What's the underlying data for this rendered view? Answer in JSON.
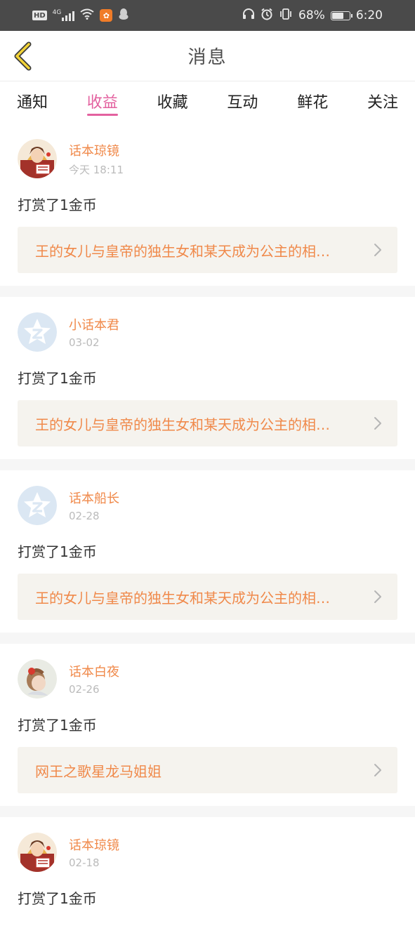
{
  "status_bar": {
    "hd": "HD",
    "network": "4G",
    "battery": "68%",
    "battery_level": 0.68,
    "time": "6:20"
  },
  "header": {
    "title": "消息"
  },
  "tabs": [
    {
      "label": "通知",
      "active": false
    },
    {
      "label": "收益",
      "active": true
    },
    {
      "label": "收藏",
      "active": false
    },
    {
      "label": "互动",
      "active": false
    },
    {
      "label": "鲜花",
      "active": false
    },
    {
      "label": "关注",
      "active": false
    }
  ],
  "accent_color": "#e3619f",
  "name_color": "#f0894a",
  "messages": [
    {
      "username": "话本琼镜",
      "time": "今天 18:11",
      "action": "打赏了1金币",
      "book": "王的女儿与皇帝的独生女和某天成为公主的相…",
      "avatar": "illustrated-avatar"
    },
    {
      "username": "小话本君",
      "time": "03-02",
      "action": "打赏了1金币",
      "book": "王的女儿与皇帝的独生女和某天成为公主的相…",
      "avatar": "default-star-avatar"
    },
    {
      "username": "话本船长",
      "time": "02-28",
      "action": "打赏了1金币",
      "book": "王的女儿与皇帝的独生女和某天成为公主的相…",
      "avatar": "default-star-avatar"
    },
    {
      "username": "话本白夜",
      "time": "02-26",
      "action": "打赏了1金币",
      "book": "网王之歌星龙马姐姐",
      "avatar": "photo-avatar"
    },
    {
      "username": "话本琼镜",
      "time": "02-18",
      "action": "打赏了1金币",
      "book": "",
      "avatar": "illustrated-avatar"
    }
  ]
}
